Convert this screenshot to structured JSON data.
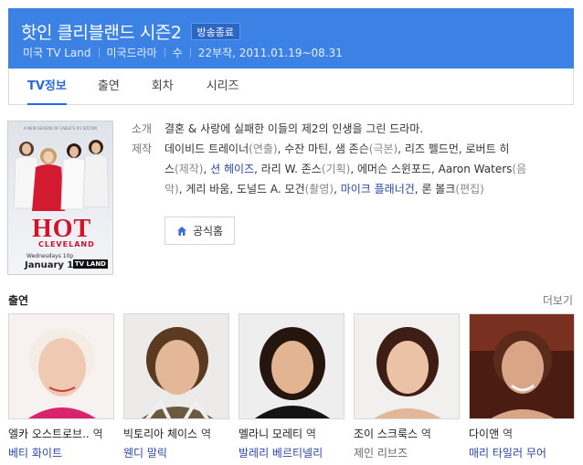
{
  "header": {
    "title": "핫인 클리블랜드 시즌2",
    "badge": "방송종료",
    "meta": [
      "미국 TV Land",
      "미국드라마",
      "수",
      "22부작, 2011.01.19~08.31"
    ]
  },
  "tabs": [
    {
      "label": "TV정보",
      "active": true
    },
    {
      "label": "출연",
      "active": false
    },
    {
      "label": "회차",
      "active": false
    },
    {
      "label": "시리즈",
      "active": false
    }
  ],
  "poster": {
    "tagline": "A NEW SEASON OF CABLE'S #1 SITCOM",
    "title": "HOT",
    "subtitle": "CLEVELAND",
    "airtime": "Wednesdays 10p",
    "date": "January 19",
    "logo": "TV LAND"
  },
  "info": {
    "summary_label": "소개",
    "summary": "결혼 & 사랑에 실패한 이들의 제2의 인생을 그린 드라마.",
    "credits_label": "제작"
  },
  "credits_lines": [
    [
      {
        "t": "데이비드 트레이너"
      },
      {
        "t": "(연출)",
        "role": true
      },
      {
        "t": ", 수잔 마틴, 샘 존슨"
      },
      {
        "t": "(극본)",
        "role": true
      },
      {
        "t": ", 리즈 펠드먼, 로버트 히"
      }
    ],
    [
      {
        "t": "스"
      },
      {
        "t": "(제작)",
        "role": true
      },
      {
        "t": ", "
      },
      {
        "t": "션 헤이즈",
        "link": true
      },
      {
        "t": ", 라리 W. 존스"
      },
      {
        "t": "(기획)",
        "role": true
      },
      {
        "t": ", 에머슨 스윈포드, Aaron Waters"
      },
      {
        "t": "(음",
        "role": true
      }
    ],
    [
      {
        "t": "악)",
        "role": true
      },
      {
        "t": ", 게리 바움, 도널드 A. 모건"
      },
      {
        "t": "(촬영)",
        "role": true
      },
      {
        "t": ", "
      },
      {
        "t": "마이크 플래너건",
        "link": true
      },
      {
        "t": ", 론 볼크"
      },
      {
        "t": "(편집)",
        "role": true
      }
    ]
  ],
  "home_button": "공식홈",
  "cast": {
    "title": "출연",
    "more": "더보기",
    "members": [
      {
        "role": "엘카 오스트로브..",
        "suffix": "역",
        "actor": "베티 화이트",
        "linked": true
      },
      {
        "role": "빅토리아 체이스",
        "suffix": "역",
        "actor": "웬디 말릭",
        "linked": true
      },
      {
        "role": "멜라니 모레티",
        "suffix": "역",
        "actor": "발레리 베르티넬리",
        "linked": true
      },
      {
        "role": "조이 스크룩스",
        "suffix": "역",
        "actor": "제인 리브즈",
        "linked": false
      },
      {
        "role": "다이앤",
        "suffix": "역",
        "actor": "매리 타일러 무어",
        "linked": true
      }
    ]
  },
  "colors": {
    "header_bg": "#3b82e4",
    "accent": "#2a6ad9",
    "link": "#2a48a8",
    "poster_red": "#d3122a"
  }
}
